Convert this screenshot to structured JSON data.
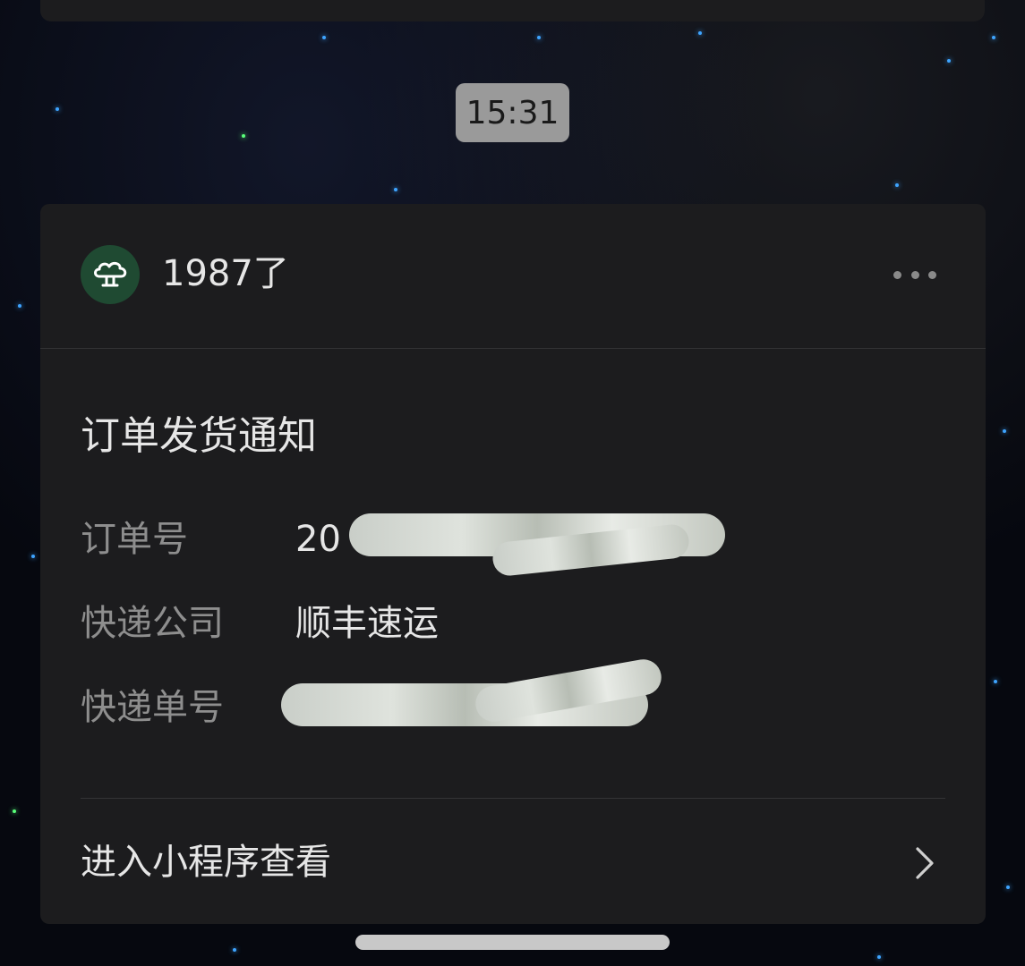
{
  "chat": {
    "timestamp": "15:31"
  },
  "card": {
    "shop_name": "1987了",
    "avatar_icon": "cloud-tree-icon",
    "more_icon": "more-dots-icon",
    "title": "订单发货通知",
    "rows": [
      {
        "label": "订单号",
        "value": "20"
      },
      {
        "label": "快递公司",
        "value": "顺丰速运"
      },
      {
        "label": "快递单号",
        "value": ""
      }
    ],
    "footer_label": "进入小程序查看",
    "footer_icon": "chevron-right-icon"
  },
  "colors": {
    "card_bg": "#1c1c1e",
    "avatar_bg": "#1f4a32",
    "text_primary": "#e6e6e6",
    "text_secondary": "#8e8e8e",
    "time_badge_bg": "#9a9a9a"
  }
}
